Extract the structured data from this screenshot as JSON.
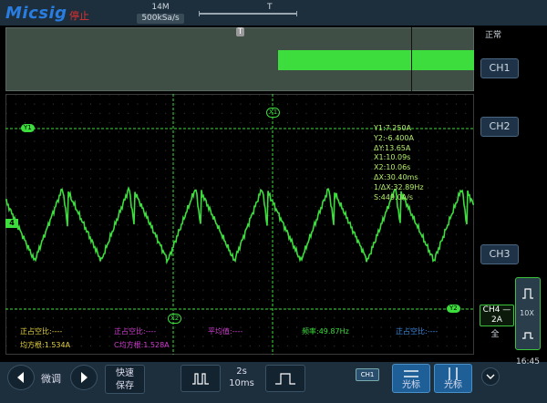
{
  "app": {
    "logo": "Micsig",
    "run_state": "停止",
    "mem_depth": "14M",
    "sample_rate": "500kSa/s",
    "status": "正常"
  },
  "channels": {
    "ch1": "CH1",
    "ch2": "CH2",
    "ch3": "CH3",
    "ch4_line1": "CH4 —",
    "ch4_line2": "2A",
    "full": "全",
    "probe": "10X"
  },
  "markers": {
    "trigger_top": "T",
    "overview_trigger": "T",
    "ch4_marker": "4",
    "cursor_y1": "Y1",
    "cursor_y2": "Y2",
    "cursor_x1": "X1",
    "cursor_x2": "X2"
  },
  "cursor_readout": [
    "Y1:7.250A",
    "Y2:-6.400A",
    "ΔY:13.65A",
    "X1:10.09s",
    "X2:10.06s",
    "ΔX:30.40ms",
    "1/ΔX:32.89Hz",
    "S:449.0A/s"
  ],
  "measurements": {
    "pos_duty_1": "正占空比:----",
    "rms_1": "均方根:1.534A",
    "pos_duty_2": "正占空比:----",
    "rms_2": "C均方根:1.528A",
    "mean": "平均值:----",
    "freq": "频率:49.87Hz",
    "pos_duty_3": "正占空比:----"
  },
  "toolbar": {
    "fine": "微调",
    "quicksave_1": "快速",
    "quicksave_2": "保存",
    "timebase_1": "2s",
    "timebase_2": "10ms",
    "ch1_chip": "CH1",
    "cursor_label": "光标",
    "time": "16:45"
  },
  "colors": {
    "accent": "#1f5f98",
    "trace": "#3cdd3c",
    "readout": "#b4ee6a",
    "stop": "#e03030",
    "magenta": "#d23cd2",
    "yellow": "#e6d23c"
  }
}
